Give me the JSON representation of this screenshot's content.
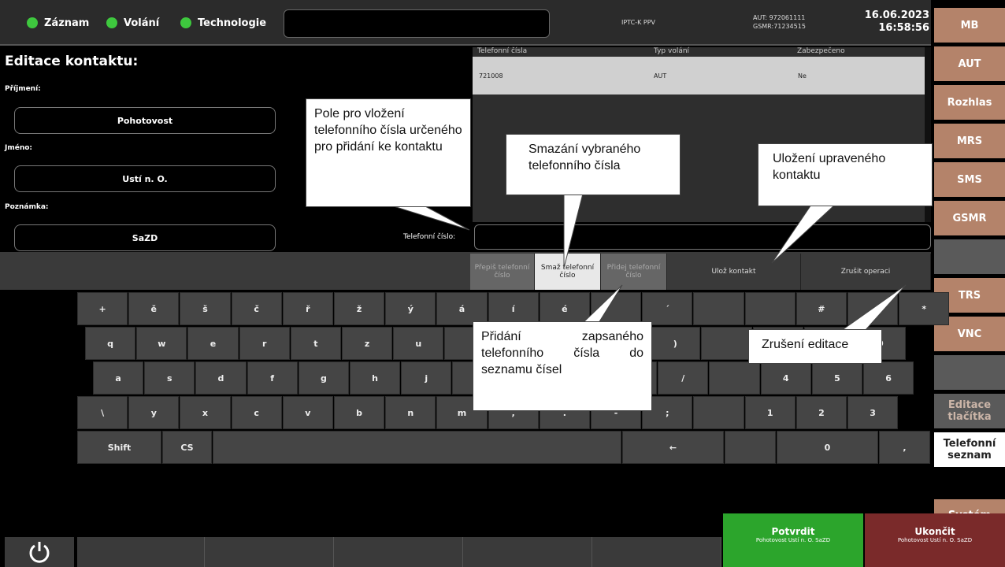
{
  "status": {
    "indicators": [
      "Záznam",
      "Volání",
      "Technologie"
    ],
    "terminal": "IPTC-K PPV",
    "aut": "AUT: 972061111",
    "gsmr": "GSMR:71234515",
    "date": "16.06.2023",
    "time": "16:58:56",
    "colors": {
      "indicator_green": "#3ec83e",
      "menu_brown": "#b4836a",
      "confirm_green": "#2ca52c",
      "end_red": "#7a2a2a"
    }
  },
  "right_menu": [
    "MB",
    "AUT",
    "Rozhlas",
    "MRS",
    "SMS",
    "GSMR",
    "",
    "TRS",
    "VNC",
    "",
    "Editace tlačítka",
    "Telefonní seznam",
    "Systém"
  ],
  "form": {
    "title": "Editace kontaktu:",
    "surname_label": "Příjmení:",
    "surname_value": "Pohotovost",
    "name_label": "Jméno:",
    "name_value": "Ustí n. O.",
    "note_label": "Poznámka:",
    "note_value": "SaZD",
    "phone_label": "Telefonní číslo:",
    "phone_value": ""
  },
  "table": {
    "headers": [
      "Telefonní čísla",
      "Typ volání",
      "Zabezpečeno"
    ],
    "rows": [
      [
        "721008",
        "AUT",
        "Ne"
      ]
    ]
  },
  "actions": {
    "rewrite": "Přepiš telefonní číslo",
    "delete": "Smaž telefonní číslo",
    "add": "Přidej telefonní číslo",
    "save": "Ulož kontakt",
    "cancel": "Zrušit operaci"
  },
  "keyboard": {
    "row1": [
      "+",
      "ě",
      "š",
      "č",
      "ř",
      "ž",
      "ý",
      "á",
      "í",
      "é",
      "",
      "´",
      "",
      "",
      "#",
      "",
      "*"
    ],
    "row2": [
      "q",
      "w",
      "e",
      "r",
      "t",
      "z",
      "u",
      "",
      "",
      "",
      "",
      ")",
      "",
      "",
      "",
      "9"
    ],
    "row3": [
      "a",
      "s",
      "d",
      "f",
      "g",
      "h",
      "j",
      "",
      "",
      "",
      "",
      "/",
      "",
      "4",
      "5",
      "6"
    ],
    "row4": [
      "\\",
      "y",
      "x",
      "c",
      "v",
      "b",
      "n",
      "m",
      ",",
      ".",
      "-",
      ";",
      "",
      "1",
      "2",
      "3"
    ],
    "row5": [
      "Shift",
      "CS",
      "",
      "←",
      "",
      "0",
      ","
    ]
  },
  "bottom": {
    "power_icon": "power-icon",
    "confirm_label": "Potvrdit",
    "confirm_sub": "Pohotovost Ustí n. O. SaZD",
    "end_label": "Ukončit",
    "end_sub": "Pohotovost Ustí n. O. SaZD"
  },
  "callouts": {
    "phone_field": "Pole pro vložení telefonního čísla určeného pro přidání ke kontaktu",
    "delete_number": "Smazání vybraného telefonního čísla",
    "save_contact": "Uložení upraveného kontaktu",
    "add_number": "Přidání zapsaného telefonního čísla do seznamu čísel",
    "cancel_edit": "Zrušení editace"
  }
}
